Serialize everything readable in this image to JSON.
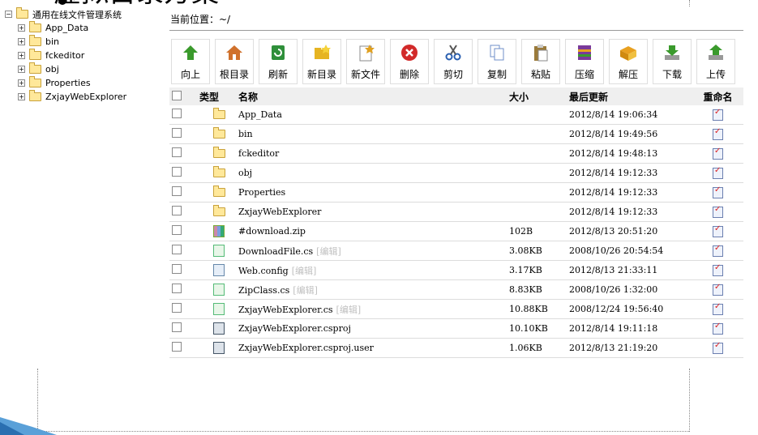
{
  "slide": {
    "title": "虚拟目录方案"
  },
  "tree": {
    "root": "通用在线文件管理系统",
    "items": [
      "App_Data",
      "bin",
      "fckeditor",
      "obj",
      "Properties",
      "ZxjayWebExplorer"
    ]
  },
  "path": {
    "label": "当前位置：~/"
  },
  "toolbar": [
    {
      "label": "向上",
      "icon": "up-arrow-icon",
      "color": "#3a9a2c"
    },
    {
      "label": "根目录",
      "icon": "home-icon",
      "color": "#d0712c"
    },
    {
      "label": "刷新",
      "icon": "refresh-icon",
      "color": "#2f8f3a"
    },
    {
      "label": "新目录",
      "icon": "new-folder-icon",
      "color": "#e6b422"
    },
    {
      "label": "新文件",
      "icon": "new-file-icon",
      "color": "#e0a020"
    },
    {
      "label": "删除",
      "icon": "delete-icon",
      "color": "#d22a2a"
    },
    {
      "label": "剪切",
      "icon": "scissors-icon",
      "color": "#2a5fb0"
    },
    {
      "label": "复制",
      "icon": "copy-icon",
      "color": "#6f8fc8"
    },
    {
      "label": "粘贴",
      "icon": "paste-icon",
      "color": "#9a7a3a"
    },
    {
      "label": "压缩",
      "icon": "compress-icon",
      "color": "#7a3a9a"
    },
    {
      "label": "解压",
      "icon": "extract-icon",
      "color": "#e8a020"
    },
    {
      "label": "下载",
      "icon": "download-icon",
      "color": "#3a9a2c"
    },
    {
      "label": "上传",
      "icon": "upload-icon",
      "color": "#3a9a2c"
    }
  ],
  "table": {
    "headers": {
      "type": "类型",
      "name": "名称",
      "size": "大小",
      "modified": "最后更新",
      "rename": "重命名"
    },
    "edit_label": "[编辑]",
    "rows": [
      {
        "kind": "folder",
        "name": "App_Data",
        "size": "",
        "modified": "2012/8/14 19:06:34",
        "editable": false
      },
      {
        "kind": "folder",
        "name": "bin",
        "size": "",
        "modified": "2012/8/14 19:49:56",
        "editable": false
      },
      {
        "kind": "folder",
        "name": "fckeditor",
        "size": "",
        "modified": "2012/8/14 19:48:13",
        "editable": false
      },
      {
        "kind": "folder",
        "name": "obj",
        "size": "",
        "modified": "2012/8/14 19:12:33",
        "editable": false
      },
      {
        "kind": "folder",
        "name": "Properties",
        "size": "",
        "modified": "2012/8/14 19:12:33",
        "editable": false
      },
      {
        "kind": "folder",
        "name": "ZxjayWebExplorer",
        "size": "",
        "modified": "2012/8/14 19:12:33",
        "editable": false
      },
      {
        "kind": "zip",
        "name": "#download.zip",
        "size": "102B",
        "modified": "2012/8/13 20:51:20",
        "editable": false
      },
      {
        "kind": "cs",
        "name": "DownloadFile.cs",
        "size": "3.08KB",
        "modified": "2008/10/26 20:54:54",
        "editable": true
      },
      {
        "kind": "cfg",
        "name": "Web.config",
        "size": "3.17KB",
        "modified": "2012/8/13 21:33:11",
        "editable": true
      },
      {
        "kind": "cs",
        "name": "ZipClass.cs",
        "size": "8.83KB",
        "modified": "2008/10/26 1:32:00",
        "editable": true
      },
      {
        "kind": "cs",
        "name": "ZxjayWebExplorer.cs",
        "size": "10.88KB",
        "modified": "2008/12/24 19:56:40",
        "editable": true
      },
      {
        "kind": "proj",
        "name": "ZxjayWebExplorer.csproj",
        "size": "10.10KB",
        "modified": "2012/8/14 19:11:18",
        "editable": false
      },
      {
        "kind": "proj",
        "name": "ZxjayWebExplorer.csproj.user",
        "size": "1.06KB",
        "modified": "2012/8/13 21:19:20",
        "editable": false
      }
    ]
  }
}
